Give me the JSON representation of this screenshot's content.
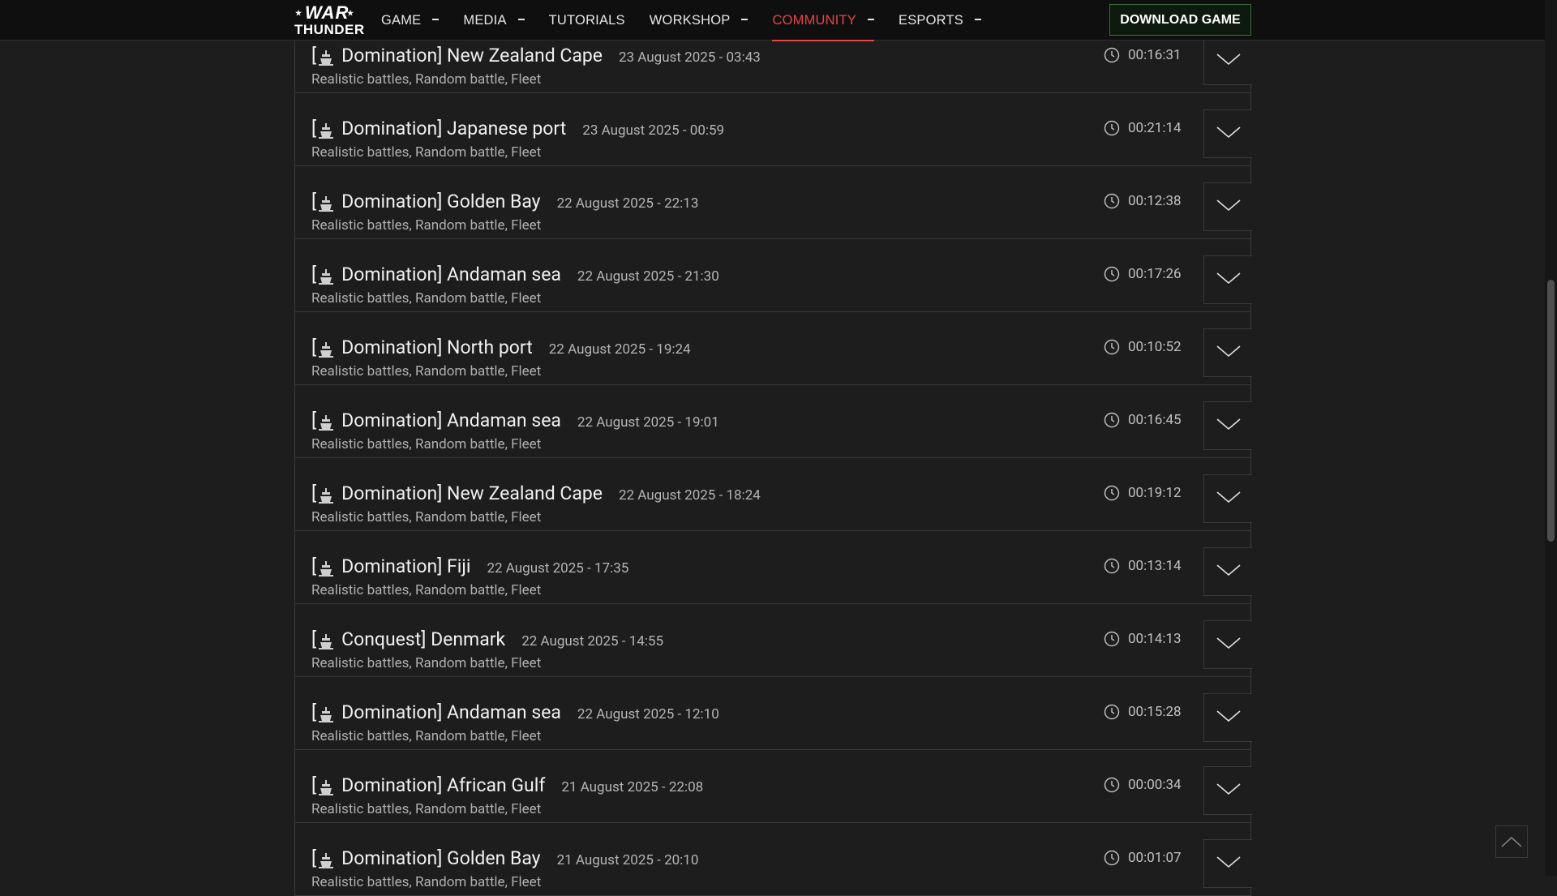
{
  "header": {
    "logo": {
      "line1": "WAR",
      "line2": "THUNDER"
    },
    "nav": [
      {
        "label": "GAME",
        "has_caret": true,
        "active": false
      },
      {
        "label": "MEDIA",
        "has_caret": true,
        "active": false
      },
      {
        "label": "TUTORIALS",
        "has_caret": false,
        "active": false
      },
      {
        "label": "WORKSHOP",
        "has_caret": true,
        "active": false
      },
      {
        "label": "COMMUNITY",
        "has_caret": true,
        "active": true
      },
      {
        "label": "ESPORTS",
        "has_caret": true,
        "active": false
      }
    ],
    "download_label": "DOWNLOAD GAME"
  },
  "theme": {
    "background": "#1d1d1d",
    "accent_red": "#e64545",
    "download_border": "#3f6a3f"
  },
  "battles": [
    {
      "mode": "Domination",
      "map": "New Zealand Cape",
      "date": "23 August 2025 - 03:43",
      "duration": "00:16:31",
      "modes": "Realistic battles, Random battle, Fleet",
      "icon": "ship-icon"
    },
    {
      "mode": "Domination",
      "map": "Japanese port",
      "date": "23 August 2025 - 00:59",
      "duration": "00:21:14",
      "modes": "Realistic battles, Random battle, Fleet",
      "icon": "ship-icon"
    },
    {
      "mode": "Domination",
      "map": "Golden Bay",
      "date": "22 August 2025 - 22:13",
      "duration": "00:12:38",
      "modes": "Realistic battles, Random battle, Fleet",
      "icon": "ship-icon"
    },
    {
      "mode": "Domination",
      "map": "Andaman sea",
      "date": "22 August 2025 - 21:30",
      "duration": "00:17:26",
      "modes": "Realistic battles, Random battle, Fleet",
      "icon": "ship-icon"
    },
    {
      "mode": "Domination",
      "map": "North port",
      "date": "22 August 2025 - 19:24",
      "duration": "00:10:52",
      "modes": "Realistic battles, Random battle, Fleet",
      "icon": "ship-icon"
    },
    {
      "mode": "Domination",
      "map": "Andaman sea",
      "date": "22 August 2025 - 19:01",
      "duration": "00:16:45",
      "modes": "Realistic battles, Random battle, Fleet",
      "icon": "ship-icon"
    },
    {
      "mode": "Domination",
      "map": "New Zealand Cape",
      "date": "22 August 2025 - 18:24",
      "duration": "00:19:12",
      "modes": "Realistic battles, Random battle, Fleet",
      "icon": "ship-icon"
    },
    {
      "mode": "Domination",
      "map": "Fiji",
      "date": "22 August 2025 - 17:35",
      "duration": "00:13:14",
      "modes": "Realistic battles, Random battle, Fleet",
      "icon": "ship-icon"
    },
    {
      "mode": "Conquest",
      "map": "Denmark",
      "date": "22 August 2025 - 14:55",
      "duration": "00:14:13",
      "modes": "Realistic battles, Random battle, Fleet",
      "icon": "ship-icon"
    },
    {
      "mode": "Domination",
      "map": "Andaman sea",
      "date": "22 August 2025 - 12:10",
      "duration": "00:15:28",
      "modes": "Realistic battles, Random battle, Fleet",
      "icon": "ship-icon"
    },
    {
      "mode": "Domination",
      "map": "African Gulf",
      "date": "21 August 2025 - 22:08",
      "duration": "00:00:34",
      "modes": "Realistic battles, Random battle, Fleet",
      "icon": "ship-icon"
    },
    {
      "mode": "Domination",
      "map": "Golden Bay",
      "date": "21 August 2025 - 20:10",
      "duration": "00:01:07",
      "modes": "Realistic battles, Random battle, Fleet",
      "icon": "ship-icon"
    }
  ],
  "icons": {
    "expand": "chevron-down-icon",
    "duration": "clock-icon",
    "back_to_top": "chevron-up-icon"
  }
}
